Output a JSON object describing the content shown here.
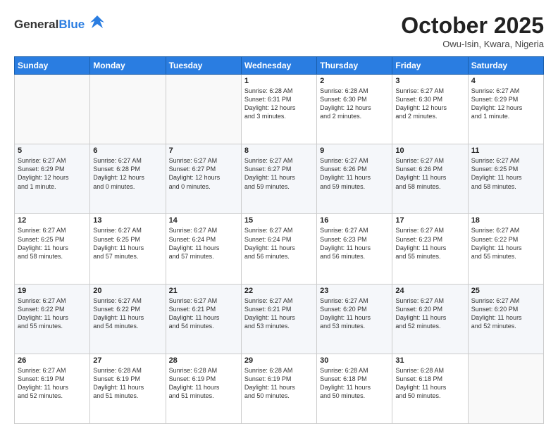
{
  "header": {
    "logo_general": "General",
    "logo_blue": "Blue",
    "month_title": "October 2025",
    "location": "Owu-Isin, Kwara, Nigeria"
  },
  "weekdays": [
    "Sunday",
    "Monday",
    "Tuesday",
    "Wednesday",
    "Thursday",
    "Friday",
    "Saturday"
  ],
  "weeks": [
    [
      {
        "day": "",
        "info": ""
      },
      {
        "day": "",
        "info": ""
      },
      {
        "day": "",
        "info": ""
      },
      {
        "day": "1",
        "info": "Sunrise: 6:28 AM\nSunset: 6:31 PM\nDaylight: 12 hours\nand 3 minutes."
      },
      {
        "day": "2",
        "info": "Sunrise: 6:28 AM\nSunset: 6:30 PM\nDaylight: 12 hours\nand 2 minutes."
      },
      {
        "day": "3",
        "info": "Sunrise: 6:27 AM\nSunset: 6:30 PM\nDaylight: 12 hours\nand 2 minutes."
      },
      {
        "day": "4",
        "info": "Sunrise: 6:27 AM\nSunset: 6:29 PM\nDaylight: 12 hours\nand 1 minute."
      }
    ],
    [
      {
        "day": "5",
        "info": "Sunrise: 6:27 AM\nSunset: 6:29 PM\nDaylight: 12 hours\nand 1 minute."
      },
      {
        "day": "6",
        "info": "Sunrise: 6:27 AM\nSunset: 6:28 PM\nDaylight: 12 hours\nand 0 minutes."
      },
      {
        "day": "7",
        "info": "Sunrise: 6:27 AM\nSunset: 6:27 PM\nDaylight: 12 hours\nand 0 minutes."
      },
      {
        "day": "8",
        "info": "Sunrise: 6:27 AM\nSunset: 6:27 PM\nDaylight: 11 hours\nand 59 minutes."
      },
      {
        "day": "9",
        "info": "Sunrise: 6:27 AM\nSunset: 6:26 PM\nDaylight: 11 hours\nand 59 minutes."
      },
      {
        "day": "10",
        "info": "Sunrise: 6:27 AM\nSunset: 6:26 PM\nDaylight: 11 hours\nand 58 minutes."
      },
      {
        "day": "11",
        "info": "Sunrise: 6:27 AM\nSunset: 6:25 PM\nDaylight: 11 hours\nand 58 minutes."
      }
    ],
    [
      {
        "day": "12",
        "info": "Sunrise: 6:27 AM\nSunset: 6:25 PM\nDaylight: 11 hours\nand 58 minutes."
      },
      {
        "day": "13",
        "info": "Sunrise: 6:27 AM\nSunset: 6:25 PM\nDaylight: 11 hours\nand 57 minutes."
      },
      {
        "day": "14",
        "info": "Sunrise: 6:27 AM\nSunset: 6:24 PM\nDaylight: 11 hours\nand 57 minutes."
      },
      {
        "day": "15",
        "info": "Sunrise: 6:27 AM\nSunset: 6:24 PM\nDaylight: 11 hours\nand 56 minutes."
      },
      {
        "day": "16",
        "info": "Sunrise: 6:27 AM\nSunset: 6:23 PM\nDaylight: 11 hours\nand 56 minutes."
      },
      {
        "day": "17",
        "info": "Sunrise: 6:27 AM\nSunset: 6:23 PM\nDaylight: 11 hours\nand 55 minutes."
      },
      {
        "day": "18",
        "info": "Sunrise: 6:27 AM\nSunset: 6:22 PM\nDaylight: 11 hours\nand 55 minutes."
      }
    ],
    [
      {
        "day": "19",
        "info": "Sunrise: 6:27 AM\nSunset: 6:22 PM\nDaylight: 11 hours\nand 55 minutes."
      },
      {
        "day": "20",
        "info": "Sunrise: 6:27 AM\nSunset: 6:22 PM\nDaylight: 11 hours\nand 54 minutes."
      },
      {
        "day": "21",
        "info": "Sunrise: 6:27 AM\nSunset: 6:21 PM\nDaylight: 11 hours\nand 54 minutes."
      },
      {
        "day": "22",
        "info": "Sunrise: 6:27 AM\nSunset: 6:21 PM\nDaylight: 11 hours\nand 53 minutes."
      },
      {
        "day": "23",
        "info": "Sunrise: 6:27 AM\nSunset: 6:20 PM\nDaylight: 11 hours\nand 53 minutes."
      },
      {
        "day": "24",
        "info": "Sunrise: 6:27 AM\nSunset: 6:20 PM\nDaylight: 11 hours\nand 52 minutes."
      },
      {
        "day": "25",
        "info": "Sunrise: 6:27 AM\nSunset: 6:20 PM\nDaylight: 11 hours\nand 52 minutes."
      }
    ],
    [
      {
        "day": "26",
        "info": "Sunrise: 6:27 AM\nSunset: 6:19 PM\nDaylight: 11 hours\nand 52 minutes."
      },
      {
        "day": "27",
        "info": "Sunrise: 6:28 AM\nSunset: 6:19 PM\nDaylight: 11 hours\nand 51 minutes."
      },
      {
        "day": "28",
        "info": "Sunrise: 6:28 AM\nSunset: 6:19 PM\nDaylight: 11 hours\nand 51 minutes."
      },
      {
        "day": "29",
        "info": "Sunrise: 6:28 AM\nSunset: 6:19 PM\nDaylight: 11 hours\nand 50 minutes."
      },
      {
        "day": "30",
        "info": "Sunrise: 6:28 AM\nSunset: 6:18 PM\nDaylight: 11 hours\nand 50 minutes."
      },
      {
        "day": "31",
        "info": "Sunrise: 6:28 AM\nSunset: 6:18 PM\nDaylight: 11 hours\nand 50 minutes."
      },
      {
        "day": "",
        "info": ""
      }
    ]
  ]
}
